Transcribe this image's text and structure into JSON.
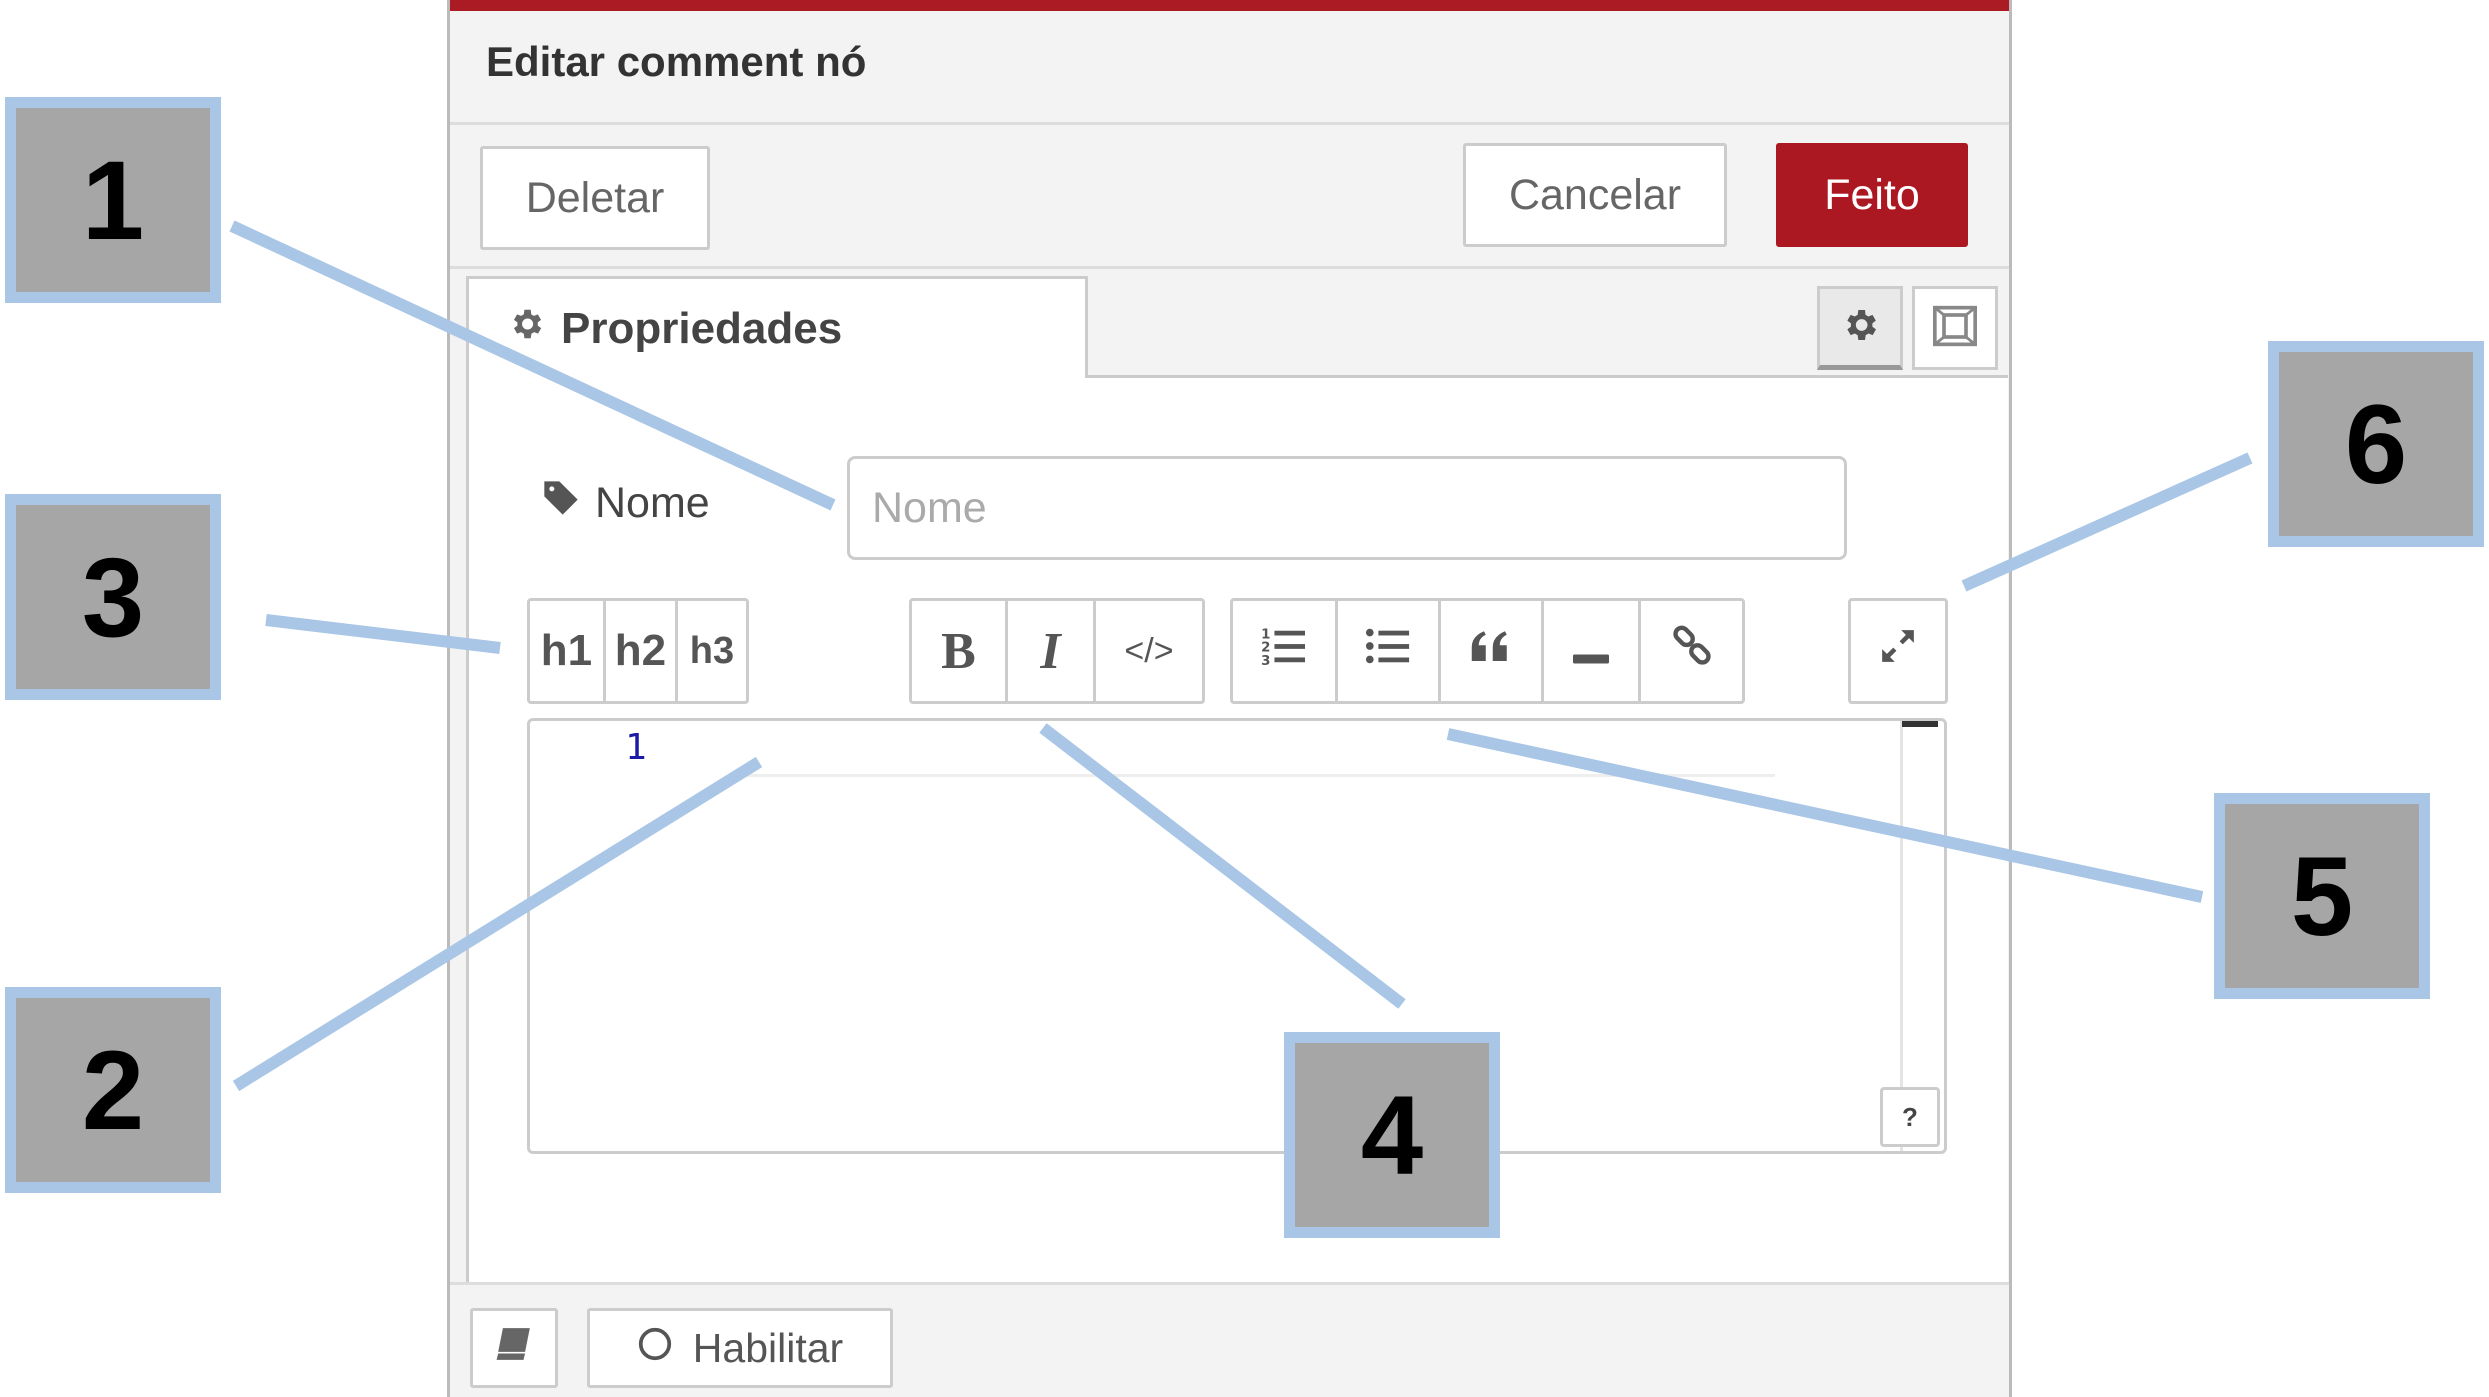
{
  "dialog": {
    "title": "Editar comment nó",
    "buttons": {
      "delete": "Deletar",
      "cancel": "Cancelar",
      "done": "Feito"
    },
    "accent_color": "#aa1b24",
    "primary_color": "#ac1822"
  },
  "tabs": [
    {
      "label": "Propriedades",
      "icon": "gear-icon"
    }
  ],
  "tab_tools": [
    {
      "icon": "gear-icon"
    },
    {
      "icon": "frame-icon"
    }
  ],
  "form": {
    "name": {
      "label": "Nome",
      "placeholder": "Nome",
      "value": ""
    }
  },
  "toolbar": {
    "headings": [
      "h1",
      "h2",
      "h3"
    ],
    "format": [
      "B",
      "I",
      "</>"
    ],
    "blocks": [
      "numbered-list-icon",
      "bullet-list-icon",
      "quote-icon",
      "horizontal-rule-icon",
      "link-icon"
    ],
    "expand": "expand-icon"
  },
  "editor": {
    "line_number": "1",
    "help": "?"
  },
  "footer": {
    "enable": "Habilitar"
  },
  "callouts": [
    "1",
    "2",
    "3",
    "4",
    "5",
    "6"
  ],
  "callout_colors": {
    "fill": "#a6a6a6",
    "border": "#a9c6e6",
    "line": "#a9c6e6"
  }
}
